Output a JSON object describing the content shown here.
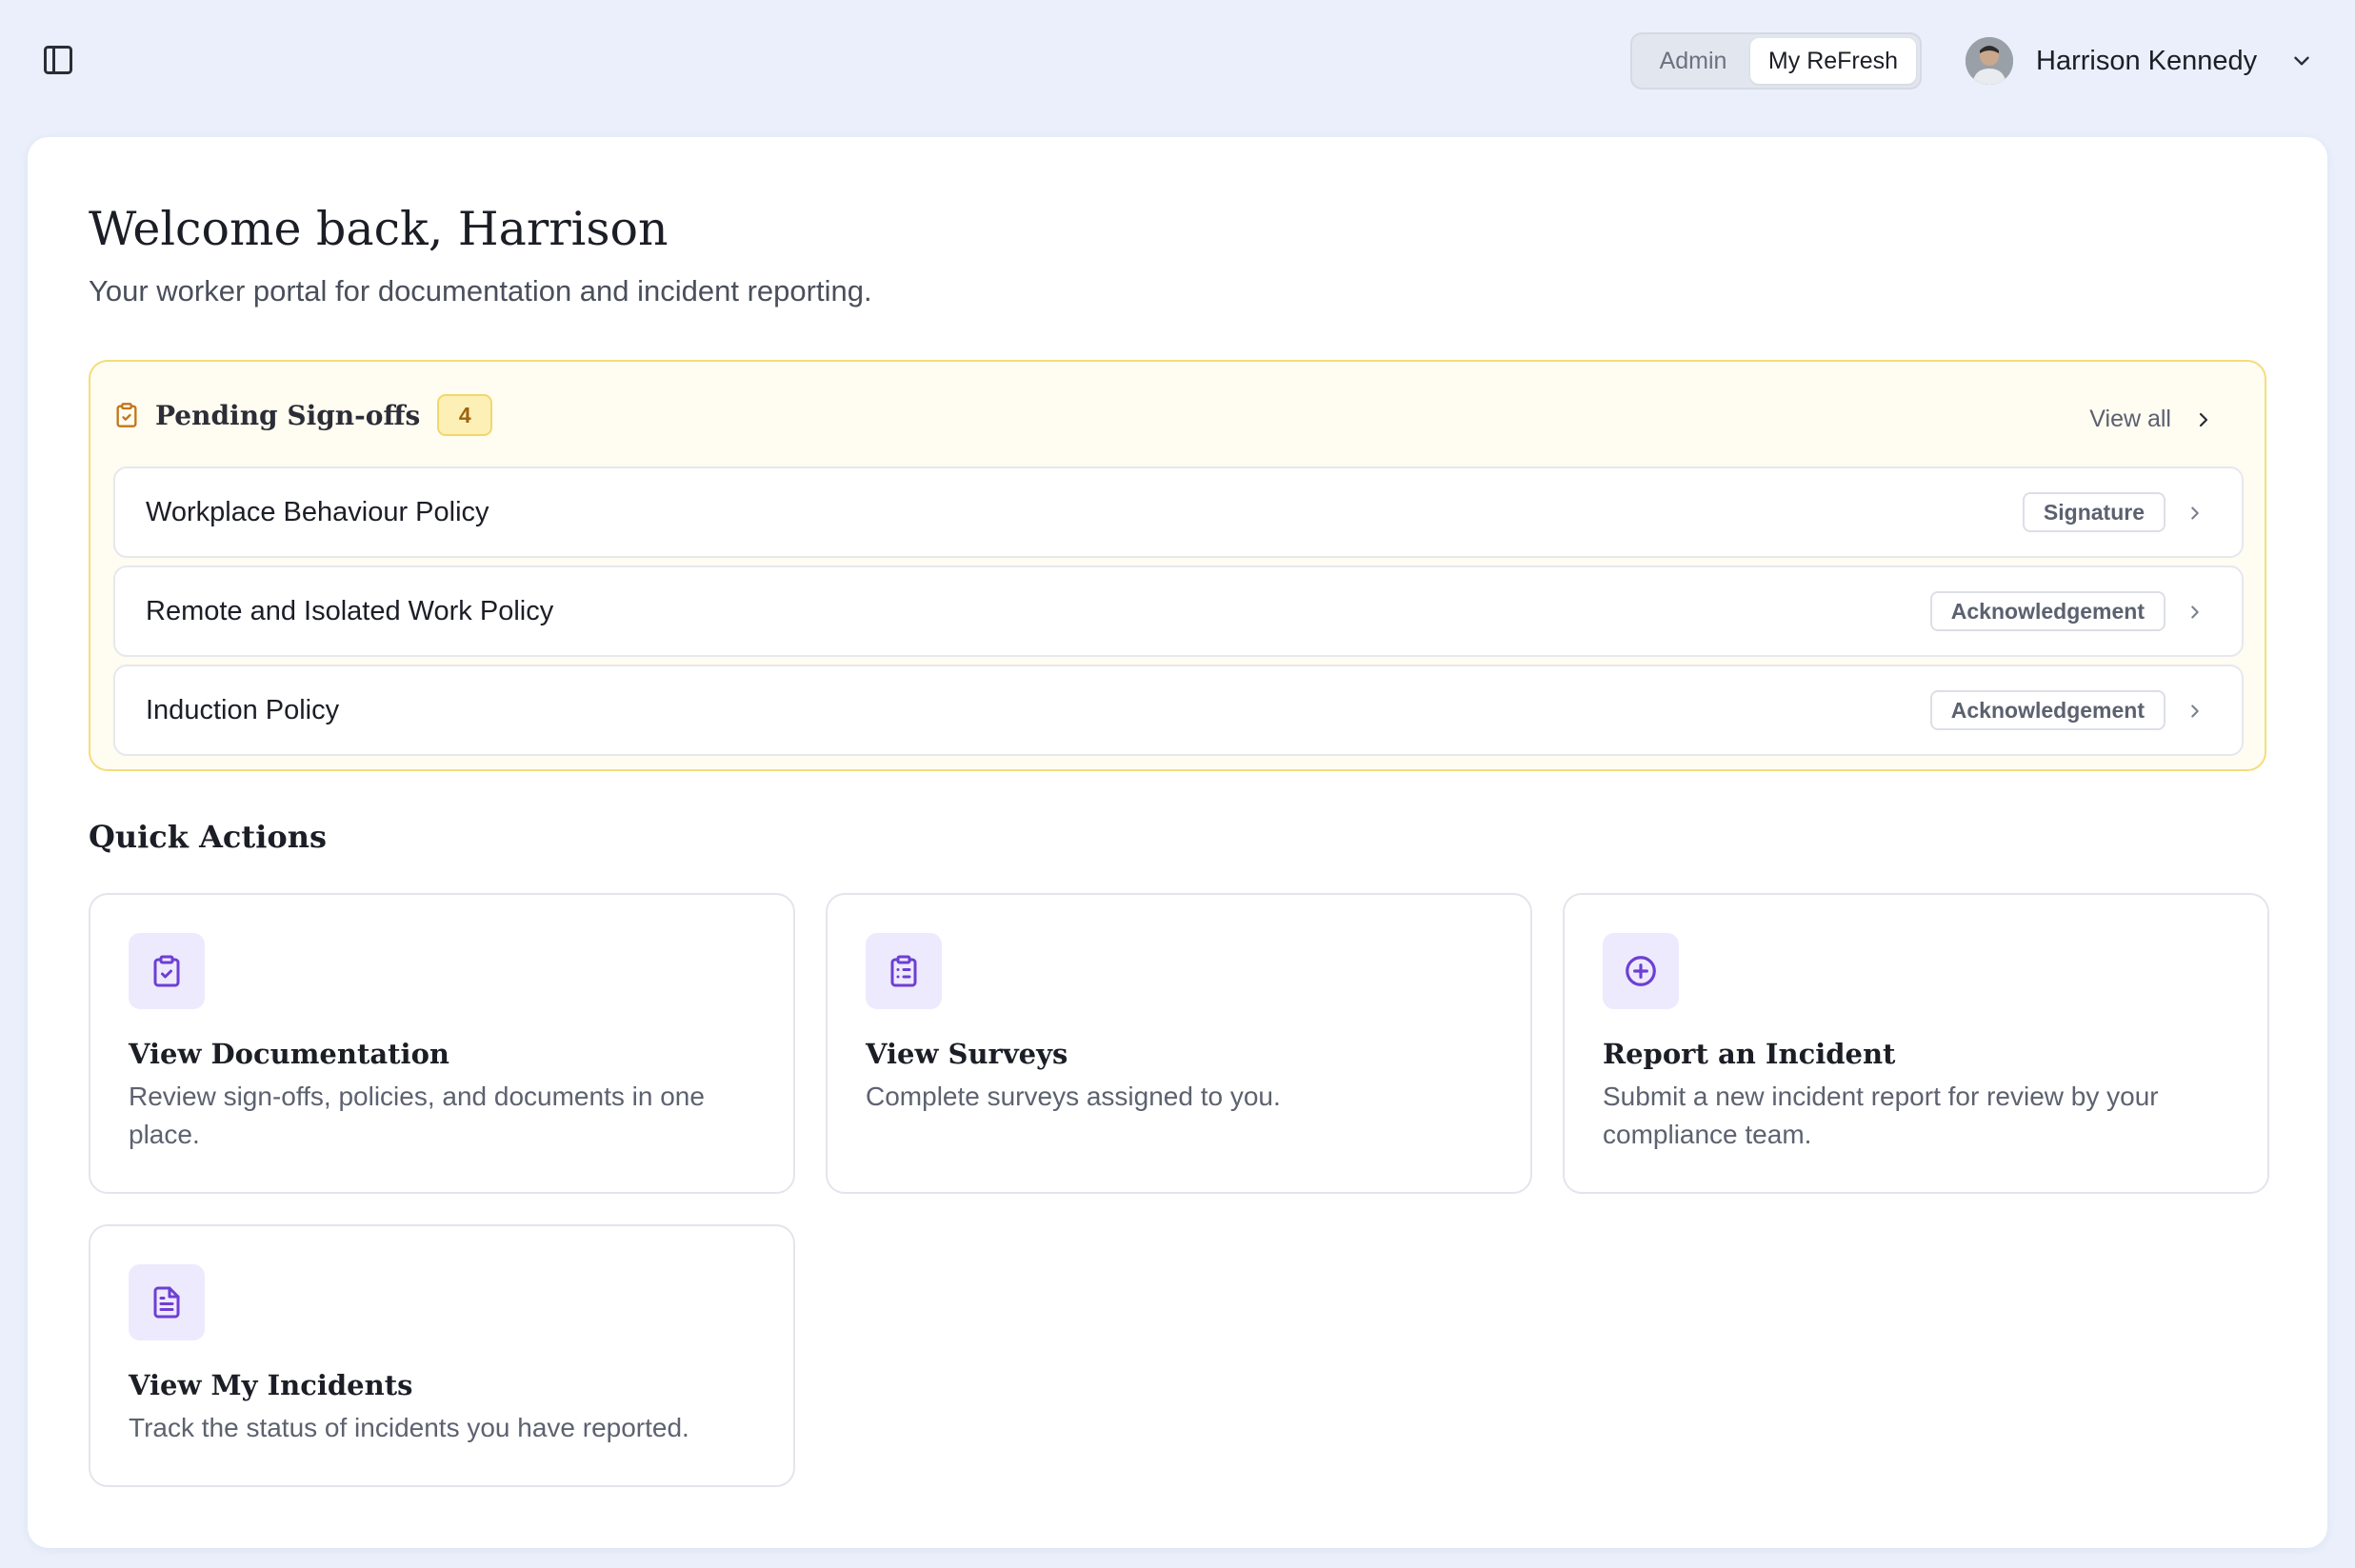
{
  "header": {
    "mode_tabs": [
      {
        "label": "Admin",
        "active": false
      },
      {
        "label": "My ReFresh",
        "active": true
      }
    ],
    "user": {
      "name": "Harrison Kennedy"
    }
  },
  "welcome": {
    "title": "Welcome back, Harrison",
    "subtitle": "Your worker portal for documentation and incident reporting."
  },
  "pending": {
    "title": "Pending Sign-offs",
    "count": "4",
    "view_all": "View all",
    "items": [
      {
        "title": "Workplace Behaviour Policy",
        "type": "Signature"
      },
      {
        "title": "Remote and Isolated Work Policy",
        "type": "Acknowledgement"
      },
      {
        "title": "Induction Policy",
        "type": "Acknowledgement"
      }
    ]
  },
  "quick_actions": {
    "title": "Quick Actions",
    "cards": [
      {
        "icon": "clipboard-check-icon",
        "title": "View Documentation",
        "description": "Review sign-offs, policies, and documents in one place."
      },
      {
        "icon": "clipboard-list-icon",
        "title": "View Surveys",
        "description": "Complete surveys assigned to you."
      },
      {
        "icon": "plus-circle-icon",
        "title": "Report an Incident",
        "description": "Submit a new incident report for review by your compliance team."
      },
      {
        "icon": "file-text-icon",
        "title": "View My Incidents",
        "description": "Track the status of incidents you have reported."
      }
    ]
  },
  "colors": {
    "page_bg": "#eaeffb",
    "pending_bg": "#fffcf1",
    "pending_border": "#f4dd7a",
    "pending_icon": "#c2761a",
    "accent_purple": "#6d3fd4",
    "icon_tile_bg": "#eeeafd"
  }
}
